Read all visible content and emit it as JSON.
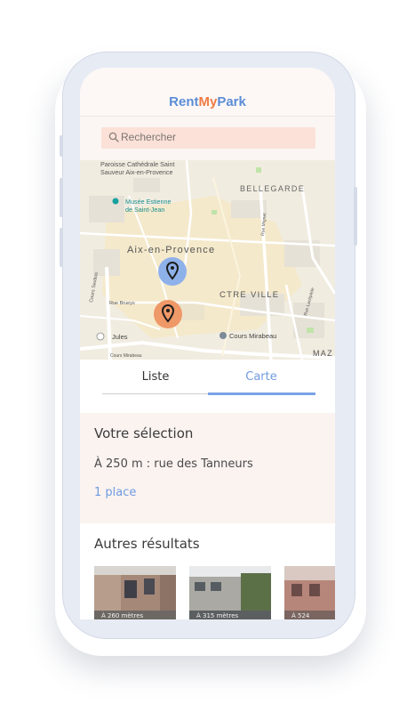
{
  "app": {
    "brand_part1": "Rent",
    "brand_part2": "My",
    "brand_part3": "Park"
  },
  "search": {
    "placeholder": "Rechercher"
  },
  "map": {
    "labels": {
      "cathedral_line1": "Paroisse Cathédrale Saint",
      "cathedral_line2": "Sauveur Aix-en-Provence",
      "museum_line1": "Musée Estienne",
      "museum_line2": "de Saint-Jean",
      "bellegarde": "BELLEGARDE",
      "city": "Aix-en-Provence",
      "centre": "CTRE VILLE",
      "cours_mirabeau": "Cours Mirabeau",
      "jules": "Jules",
      "rue_brueys": "Rue Brueys",
      "cours_sextius": "Cours Sextius",
      "rue_mignet": "Rue Mignet",
      "rue_lacepede": "Rue Lacépède",
      "cours_mirabeau_small": "Cours Mirabeau",
      "maz": "MAZ"
    }
  },
  "tabs": {
    "list_label": "Liste",
    "map_label": "Carte"
  },
  "selection": {
    "title": "Votre sélection",
    "address": "À 250 m : rue des Tanneurs",
    "places": "1 place"
  },
  "others": {
    "title": "Autres résultats",
    "cards": [
      {
        "distance": "À 260 mètres"
      },
      {
        "distance": "À 315 mètres"
      },
      {
        "distance": "À 524"
      }
    ]
  },
  "colors": {
    "brand_blue": "#5b8dd6",
    "brand_orange": "#ef7b43",
    "accent_blue": "#6f9be0",
    "pin_blue": "#8fb1ea",
    "pin_orange": "#ef9868",
    "search_bg": "#fbe1d7"
  }
}
